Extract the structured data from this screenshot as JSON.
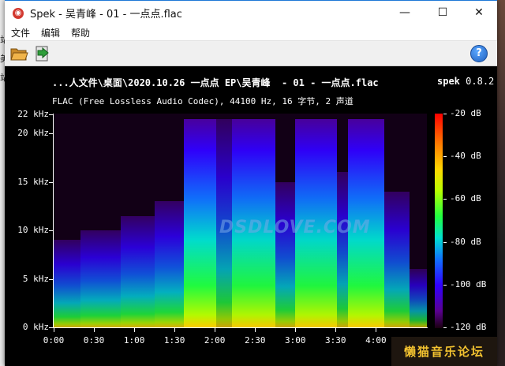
{
  "window": {
    "title": "Spek - 吴青峰  - 01 - 一点点.flac",
    "minimize_glyph": "—",
    "maximize_glyph": "☐",
    "close_glyph": "✕"
  },
  "menu": [
    "文件",
    "编辑",
    "帮助"
  ],
  "toolbar": {
    "open_icon": "folder-open-icon",
    "save_icon": "save-arrow-icon",
    "help_icon": "help-icon",
    "help_glyph": "?"
  },
  "background": {
    "left_fragments": [
      "站",
      "美",
      "站"
    ]
  },
  "spectrogram": {
    "file_path": "...人文件\\桌面\\2020.10.26 一点点 EP\\吴青峰  - 01 - 一点点.flac",
    "app_name": "spek",
    "app_version": "0.8.2",
    "info": "FLAC (Free Lossless Audio Codec), 44100 Hz, 16 字节, 2 声道",
    "watermark": "DSDLOVE.COM",
    "y_labels": [
      "22 kHz",
      "20 kHz",
      "15 kHz",
      "10 kHz",
      "5 kHz",
      "0 kHz"
    ],
    "y_values_khz": [
      22,
      20,
      15,
      10,
      5,
      0
    ],
    "x_labels": [
      "0:00",
      "0:30",
      "1:00",
      "1:30",
      "2:00",
      "2:30",
      "3:00",
      "3:30",
      "4:00"
    ],
    "x_values_sec": [
      0,
      30,
      60,
      90,
      120,
      150,
      180,
      210,
      240
    ],
    "duration_sec": 278,
    "max_khz": 22.05,
    "colorbar_labels": [
      "-20 dB",
      "-40 dB",
      "-60 dB",
      "-80 dB",
      "-100 dB",
      "-120 dB"
    ],
    "colorbar_values_db": [
      -20,
      -40,
      -60,
      -80,
      -100,
      -120
    ],
    "db_range": [
      -120,
      -20
    ],
    "segments": [
      {
        "start": 0,
        "end": 20,
        "top_khz": 9,
        "level": 0.55
      },
      {
        "start": 20,
        "end": 50,
        "top_khz": 10,
        "level": 0.6
      },
      {
        "start": 50,
        "end": 75,
        "top_khz": 11.5,
        "level": 0.62
      },
      {
        "start": 75,
        "end": 97,
        "top_khz": 13,
        "level": 0.65
      },
      {
        "start": 97,
        "end": 121,
        "top_khz": 21.5,
        "level": 0.95
      },
      {
        "start": 121,
        "end": 133,
        "top_khz": 21.5,
        "level": 0.5
      },
      {
        "start": 133,
        "end": 165,
        "top_khz": 21.5,
        "level": 0.9
      },
      {
        "start": 165,
        "end": 180,
        "top_khz": 15,
        "level": 0.55
      },
      {
        "start": 180,
        "end": 211,
        "top_khz": 21.5,
        "level": 0.92
      },
      {
        "start": 211,
        "end": 219,
        "top_khz": 16,
        "level": 0.5
      },
      {
        "start": 219,
        "end": 246,
        "top_khz": 21.5,
        "level": 0.93
      },
      {
        "start": 246,
        "end": 265,
        "top_khz": 14,
        "level": 0.55
      },
      {
        "start": 265,
        "end": 278,
        "top_khz": 6,
        "level": 0.35
      }
    ]
  },
  "badge": {
    "text": "懒猫音乐论坛"
  }
}
